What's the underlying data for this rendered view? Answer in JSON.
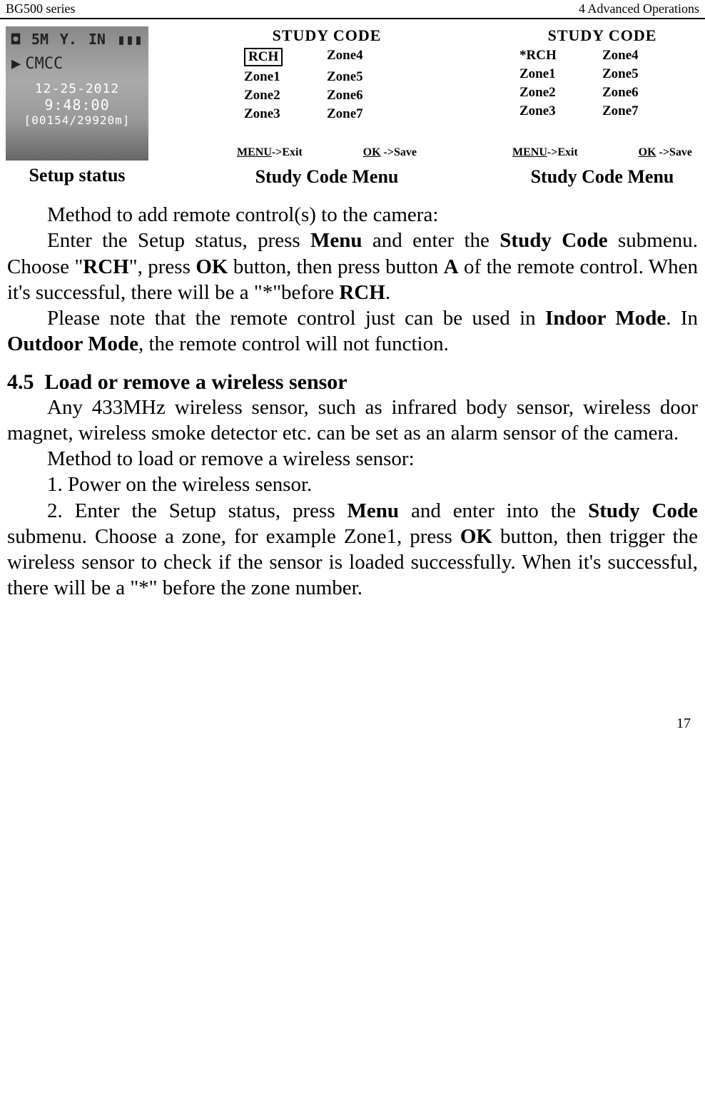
{
  "header": {
    "left": "BG500 series",
    "right": "4 Advanced Operations"
  },
  "screenshots": {
    "setup": {
      "top_left": "5M",
      "top_signal": "Y.",
      "top_in": "IN",
      "carrier": "CMCC",
      "date": "12-25-2012",
      "time": "9:48:00",
      "counter": "[00154/29920m]"
    },
    "study1": {
      "title": "STUDY  CODE",
      "rch": "RCH",
      "zones_left": [
        "Zone1",
        "Zone2",
        "Zone3"
      ],
      "zones_right": [
        "Zone4",
        "Zone5",
        "Zone6",
        "Zone7"
      ],
      "footer_exit": "MENU",
      "footer_exit_suffix": "->Exit",
      "footer_save": "OK",
      "footer_save_suffix": "->Save"
    },
    "study2": {
      "title": "STUDY  CODE",
      "rch": "*RCH",
      "zones_left": [
        "Zone1",
        "Zone2",
        "Zone3"
      ],
      "zones_right": [
        "Zone4",
        "Zone5",
        "Zone6",
        "Zone7"
      ],
      "footer_exit": "MENU",
      "footer_exit_suffix": "->Exit",
      "footer_save": "OK",
      "footer_save_suffix": "->Save"
    },
    "captions": [
      "Setup status",
      "Study Code Menu",
      "Study Code Menu"
    ]
  },
  "paragraphs": {
    "p1": "Method to add remote control(s) to the camera:",
    "p2a": "Enter the Setup status, press ",
    "p2_menu": "Menu",
    "p2b": " and enter the ",
    "p2_study": "Study Code",
    "p2c": " submenu. Choose \"",
    "p2_rch": "RCH",
    "p2d": "\", press ",
    "p2_ok": "OK",
    "p2e": " button, then press button ",
    "p2_a": "A",
    "p2f": " of the remote control. When it's successful, there will be a \"*\"before ",
    "p2_rch2": "RCH",
    "p2g": ".",
    "p3a": "Please note that the remote control just can be used in ",
    "p3_indoor": "Indoor Mode",
    "p3b": ". In ",
    "p3_outdoor": "Outdoor Mode",
    "p3c": ", the remote control will not function."
  },
  "section45": {
    "number": "4.5",
    "title": "Load or remove a wireless sensor",
    "p1": "Any 433MHz wireless sensor, such as infrared body sensor, wireless door magnet, wireless smoke detector etc. can be set as an alarm sensor of the camera.",
    "p2": "Method to load or remove a wireless sensor:",
    "p3": "1. Power on the wireless sensor.",
    "p4a": "2. Enter the Setup status, press ",
    "p4_menu": "Menu",
    "p4b": " and enter into the ",
    "p4_study": "Study Code",
    "p4c": " submenu. Choose a zone, for example Zone1, press ",
    "p4_ok": "OK",
    "p4d": " button, then trigger the wireless sensor to check if the sensor is loaded successfully. When it's successful, there will be a \"*\" before the zone number."
  },
  "page_number": "17"
}
